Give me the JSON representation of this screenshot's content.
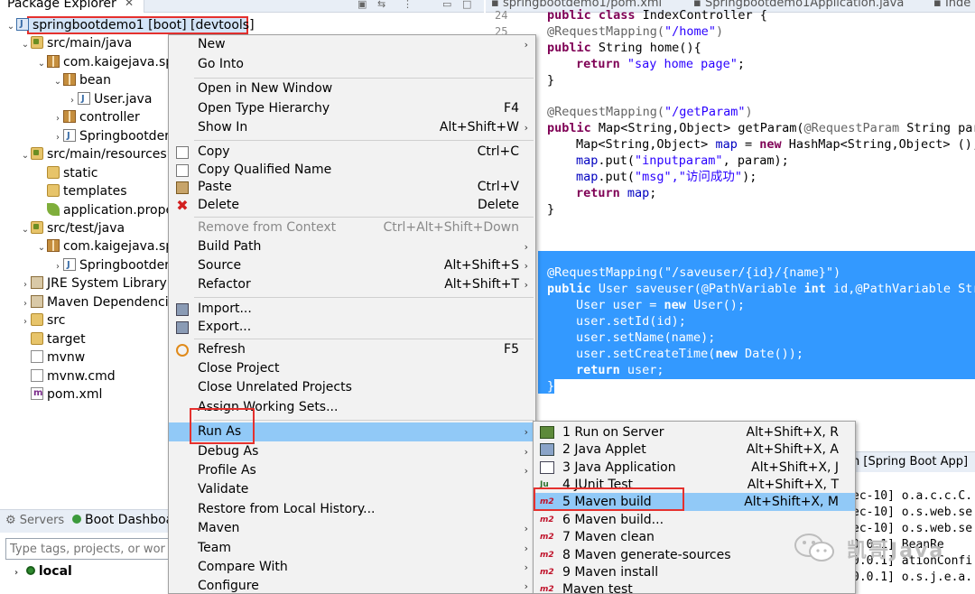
{
  "explorer": {
    "tab_label": "Package Explorer",
    "tree": [
      {
        "label": "springbootdemo1 [boot] [devtools]"
      },
      {
        "label": "src/main/java"
      },
      {
        "label": "com.kaigejava.sp"
      },
      {
        "label": "bean"
      },
      {
        "label": "User.java"
      },
      {
        "label": "controller"
      },
      {
        "label": "Springbootder"
      },
      {
        "label": "src/main/resources"
      },
      {
        "label": "static"
      },
      {
        "label": "templates"
      },
      {
        "label": "application.prope"
      },
      {
        "label": "src/test/java"
      },
      {
        "label": "com.kaigejava.sp"
      },
      {
        "label": "Springbootder"
      },
      {
        "label": "JRE System Library ["
      },
      {
        "label": "Maven Dependencie"
      },
      {
        "label": "src"
      },
      {
        "label": "target"
      },
      {
        "label": "mvnw"
      },
      {
        "label": "mvnw.cmd"
      },
      {
        "label": "pom.xml"
      }
    ]
  },
  "servers": {
    "servers_tab": "Servers",
    "dashboard_tab": "Boot Dashboa",
    "filter_placeholder": "Type tags, projects, or work",
    "local_label": "local"
  },
  "editor": {
    "tabs": [
      "springbootdemo1/pom.xml",
      "Springbootdemo1Application.java",
      "Inde"
    ],
    "line_numbers": [
      "24",
      "25"
    ],
    "code": {
      "l0_kw": "public class ",
      "l0_rest": "IndexController {",
      "l1_an": "@RequestMapping(",
      "l1_st": "\"/home\"",
      "l1_end": ")",
      "l2_kw": "public ",
      "l2_rest": "String home(){",
      "l3_kw": "return ",
      "l3_st": "\"say home page\"",
      "l3_end": ";",
      "l4": "}",
      "l5_an": "@RequestMapping(",
      "l5_st": "\"/getParam\"",
      "l5_end": ")",
      "l6_kw": "public ",
      "l6_rest": "Map<String,Object> getParam(",
      "l6_an": "@RequestParam",
      "l6_tail": " String par",
      "l7_a": "Map<String,Object> ",
      "l7_fd": "map",
      "l7_b": " = ",
      "l7_kw": "new ",
      "l7_c": "HashMap<String,Object> ();",
      "l8_fd": "map",
      "l8_a": ".put(",
      "l8_st": "\"inputparam\"",
      "l8_b": ", param);",
      "l9_fd": "map",
      "l9_a": ".put(",
      "l9_st": "\"msg\",\"访问成功\"",
      "l9_b": ");",
      "l10_kw": "return ",
      "l10_fd": "map",
      "l10_end": ";",
      "l11": "}",
      "l12": "@RequestMapping(\"/saveuser/{id}/{name}\")",
      "l13_kw": "public ",
      "l13_a": "User saveuser(@PathVariable ",
      "l13_kw2": "int ",
      "l13_b": "id,@PathVariable Str",
      "l14_a": "User user = ",
      "l14_kw": "new ",
      "l14_b": "User();",
      "l15": "user.setId(id);",
      "l16": "user.setName(name);",
      "l17_a": "user.setCreateTime(",
      "l17_kw": "new ",
      "l17_b": "Date());",
      "l18_kw": "return ",
      "l18_b": "user;",
      "l19": "}"
    }
  },
  "console": {
    "head": "n [Spring Boot App]",
    "lines": [
      "ec-10] o.a.c.c.C.",
      "ec-10] o.s.web.se",
      "ec-10] o.s.web.se",
      "0.0.1] BeanRe",
      "0.0.1] ationConfi",
      "0.0.1] o.s.j.e.a."
    ]
  },
  "context_menu": {
    "items": [
      {
        "label": "New"
      },
      {
        "label": "Go Into"
      },
      {
        "label": "Open in New Window"
      },
      {
        "label": "Open Type Hierarchy",
        "accel": "F4"
      },
      {
        "label": "Show In",
        "accel": "Alt+Shift+W"
      },
      {
        "label": "Copy",
        "accel": "Ctrl+C"
      },
      {
        "label": "Copy Qualified Name"
      },
      {
        "label": "Paste",
        "accel": "Ctrl+V"
      },
      {
        "label": "Delete",
        "accel": "Delete"
      },
      {
        "label": "Remove from Context",
        "accel": "Ctrl+Alt+Shift+Down"
      },
      {
        "label": "Build Path"
      },
      {
        "label": "Source",
        "accel": "Alt+Shift+S"
      },
      {
        "label": "Refactor",
        "accel": "Alt+Shift+T"
      },
      {
        "label": "Import..."
      },
      {
        "label": "Export..."
      },
      {
        "label": "Refresh",
        "accel": "F5"
      },
      {
        "label": "Close Project"
      },
      {
        "label": "Close Unrelated Projects"
      },
      {
        "label": "Assign Working Sets..."
      },
      {
        "label": "Run As"
      },
      {
        "label": "Debug As"
      },
      {
        "label": "Profile As"
      },
      {
        "label": "Validate"
      },
      {
        "label": "Restore from Local History..."
      },
      {
        "label": "Maven"
      },
      {
        "label": "Team"
      },
      {
        "label": "Compare With"
      },
      {
        "label": "Configure"
      }
    ]
  },
  "run_as_submenu": {
    "items": [
      {
        "label": "1 Run on Server",
        "accel": "Alt+Shift+X, R"
      },
      {
        "label": "2 Java Applet",
        "accel": "Alt+Shift+X, A"
      },
      {
        "label": "3 Java Application",
        "accel": "Alt+Shift+X, J"
      },
      {
        "label": "4 JUnit Test",
        "accel": "Alt+Shift+X, T"
      },
      {
        "label": "5 Maven build",
        "accel": "Alt+Shift+X, M"
      },
      {
        "label": "6 Maven build..."
      },
      {
        "label": "7 Maven clean"
      },
      {
        "label": "8 Maven generate-sources"
      },
      {
        "label": "9 Maven install"
      },
      {
        "label": "Maven test"
      }
    ],
    "icon_text": {
      "junit": "Ju",
      "maven": "m2"
    }
  },
  "watermark": {
    "text": "凯哥Java"
  },
  "colors": {
    "selection": "#3399ff",
    "menu_highlight": "#91c9f7",
    "annotation_box": "#e5312e"
  }
}
